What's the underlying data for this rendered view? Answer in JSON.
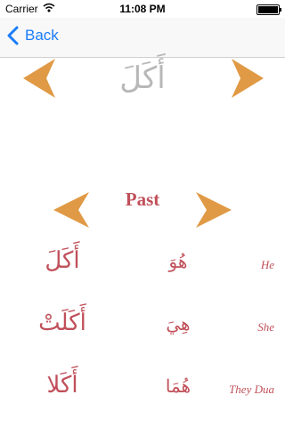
{
  "statusbar": {
    "carrier": "Carrier",
    "time": "11:08 PM"
  },
  "navbar": {
    "back_label": "Back"
  },
  "top_word": "أَكَلَ",
  "tense_label": "Past",
  "conjugations": [
    {
      "verb": "أَكَلَ",
      "pronoun_ar": "هُوَ",
      "pronoun_en": "He"
    },
    {
      "verb": "أَكَلَتْ",
      "pronoun_ar": "هِيَ",
      "pronoun_en": "She"
    },
    {
      "verb": "أَكَلا",
      "pronoun_ar": "هُمَا",
      "pronoun_en": "They Dua"
    }
  ],
  "colors": {
    "accent": "#e09a45",
    "text_red": "#c0505a",
    "link": "#1a7cf8",
    "faded": "#b8b8b8"
  }
}
